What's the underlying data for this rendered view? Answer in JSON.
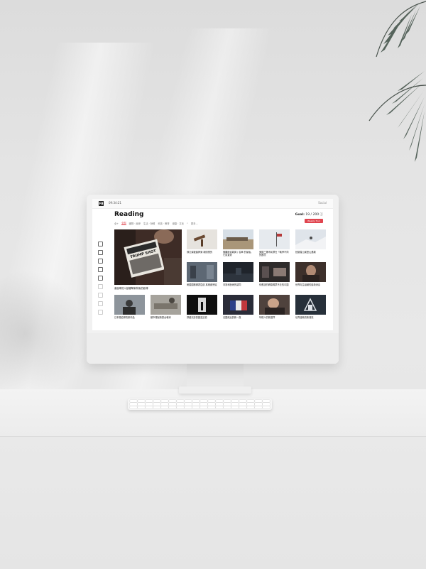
{
  "topbar": {
    "logo": "FB",
    "clock": "09:34:21",
    "right_label": "Social"
  },
  "page": {
    "title": "Reading",
    "goal_label": "Goal:",
    "goal_value": "19 / 200",
    "cta_label": "Weekly Tour"
  },
  "filters": {
    "sort_label": "全+",
    "items": [
      "全部",
      "國際 · 兩岸",
      "生活 · 財經",
      "科技 · 教育",
      "健康 · 文化"
    ],
    "active_index": 0,
    "more_label": "更多..."
  },
  "sidebar": {
    "icons": [
      "home-icon",
      "headphones-icon",
      "bookmark-icon",
      "chat-icon",
      "link-icon",
      "dot-icon",
      "dot-icon",
      "dot-icon",
      "dot-icon"
    ]
  },
  "hero": {
    "caption": "畫面寧的川讀種擊案背後的影傳",
    "headline": "TRUMP SHOT"
  },
  "tiles_row1": [
    {
      "caption": "鄭文燦被羈押案 新聞業的",
      "accent": "#9b7a5c"
    },
    {
      "caption": "俄羅斯克勒與 / 名單 的最後，它說直覺",
      "accent": "#b9a88a"
    },
    {
      "caption": "美國三藩市民眾在「戰爭不同的困境",
      "accent": "#cfd6de"
    },
    {
      "caption": "拍攝雪山某登山遇難",
      "accent": "#d9dee3"
    }
  ],
  "tiles_row2": [
    {
      "caption": "美國國務卿表暨過 某權威會議",
      "accent": "#5a6470"
    },
    {
      "caption": "非常和藝術的認同",
      "accent": "#2a2f36"
    },
    {
      "caption": "你應該的轉換嗎票不去的中國",
      "accent": "#3a3535"
    },
    {
      "caption": "世界衛生組織的最新消息",
      "accent": "#4a3a34"
    }
  ],
  "tiles_row3": [
    {
      "caption": "日本攝影師的新作品",
      "accent": "#6e757d"
    },
    {
      "caption": "都市傳說新聞台報導",
      "accent": "#8a8a86"
    },
    {
      "caption": "穿越光影的歷史記憶",
      "accent": "#141414"
    },
    {
      "caption": "法國政治的新一頁",
      "accent": "#3b3e55"
    },
    {
      "caption": "年輕人的新選擇",
      "accent": "#5b4a44"
    },
    {
      "caption": "世界建築的新潮流",
      "accent": "#2d3440"
    }
  ],
  "colors": {
    "accent_red": "#e0444e",
    "screen_bg": "#ffffff",
    "wall": "#e4e4e4"
  }
}
